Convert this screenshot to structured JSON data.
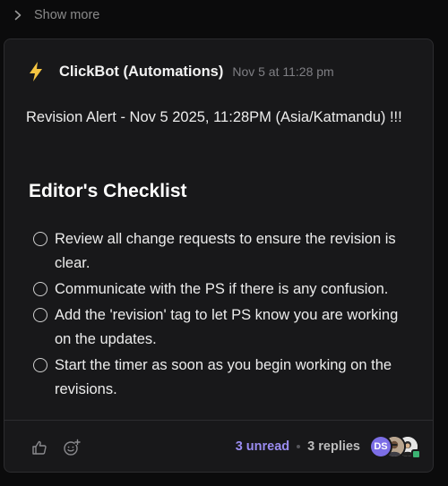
{
  "thread": {
    "show_more_label": "Show more"
  },
  "message": {
    "sender": "ClickBot (Automations)",
    "timestamp": "Nov 5 at 11:28 pm",
    "alert_text": "Revision Alert - Nov 5 2025, 11:28PM (Asia/Katmandu) !!!",
    "checklist_title": "Editor's Checklist",
    "checklist": [
      {
        "text": "Review all change requests to ensure the revision is clear.",
        "checked": false
      },
      {
        "text": "Communicate with the PS if there is any confusion.",
        "checked": false
      },
      {
        "text": "Add the 'revision' tag to let PS know you are working on the updates.",
        "checked": false
      },
      {
        "text": "Start the timer as soon as you begin working on the revisions.",
        "checked": false
      }
    ]
  },
  "footer": {
    "unread_label": "3 unread",
    "replies_label": "3 replies",
    "avatars": [
      {
        "initials": "DS",
        "color": "#7c6ee6"
      },
      {
        "icon": "user-photo"
      },
      {
        "icon": "user-photo"
      }
    ],
    "online_status_color": "#3bb273"
  },
  "colors": {
    "background": "#0b0b0c",
    "card": "#18181a",
    "accent_unread": "#9a8cf0",
    "bolt": "#f5c542"
  },
  "icons": [
    "chevron-right-icon",
    "lightning-bolt-icon",
    "thumbs-up-icon",
    "add-reaction-icon"
  ]
}
